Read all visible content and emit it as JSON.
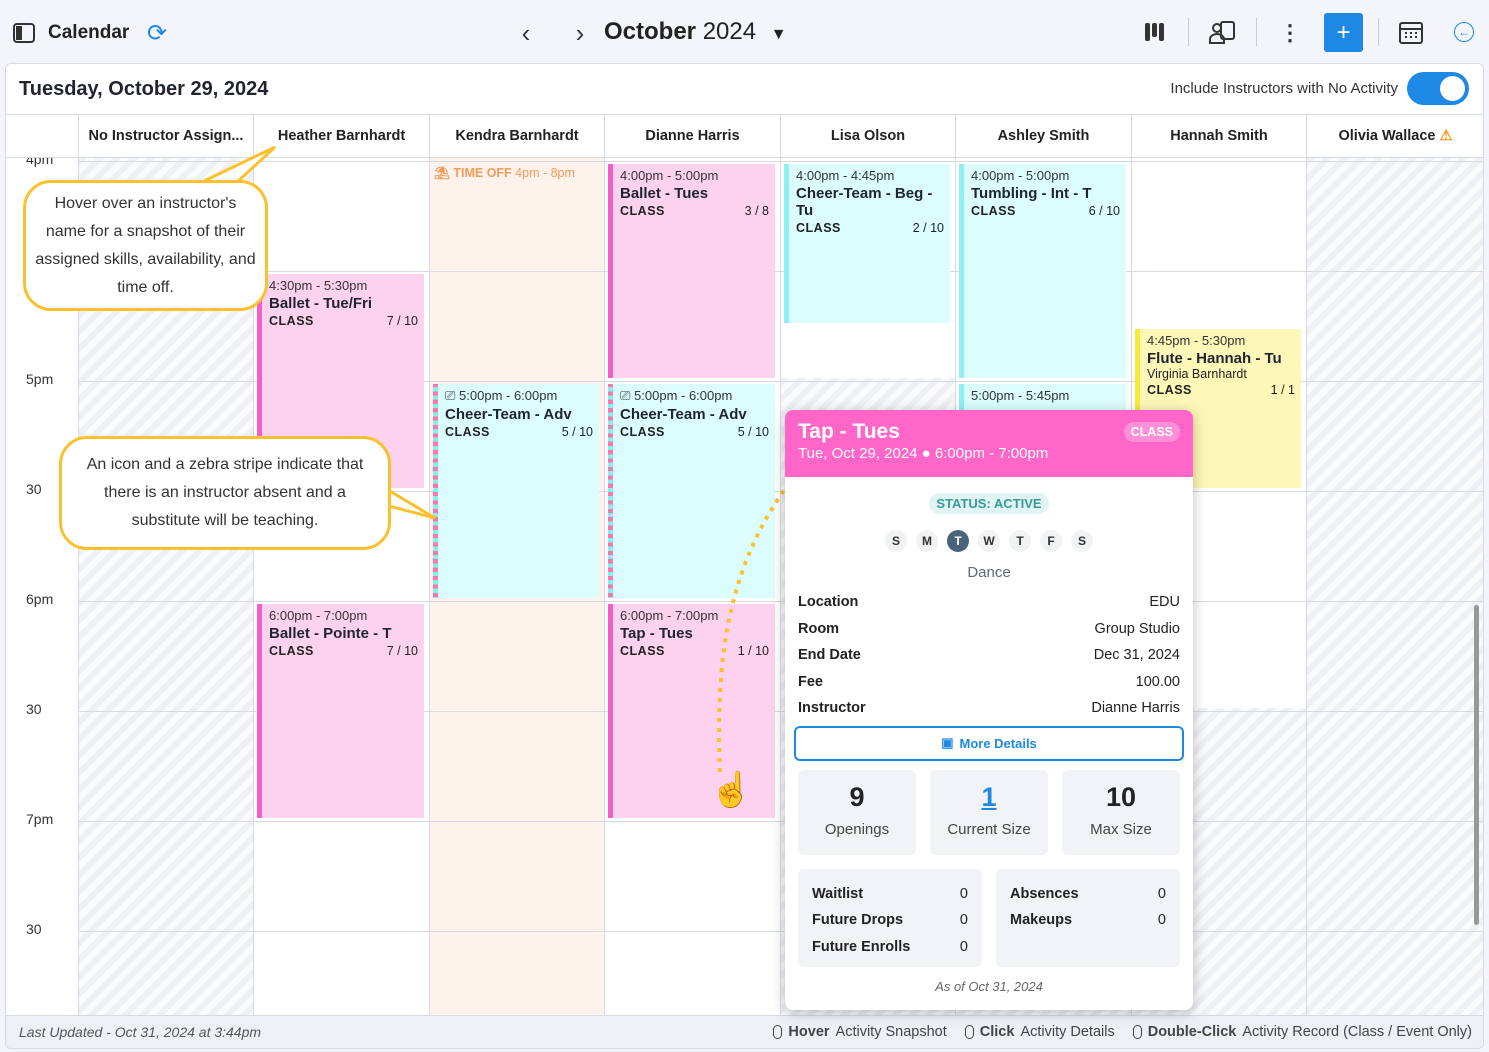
{
  "header": {
    "title": "Calendar",
    "month": "October",
    "year": "2024",
    "add_label": "+"
  },
  "panel": {
    "date_title": "Tuesday, October 29, 2024",
    "toggle_label": "Include Instructors with No Activity",
    "toggle_on": true
  },
  "instructors": [
    "No Instructor Assign...",
    "Heather Barnhardt",
    "Kendra Barnhardt",
    "Dianne Harris",
    "Lisa Olson",
    "Ashley Smith",
    "Hannah Smith",
    "Olivia Wallace"
  ],
  "time_labels": [
    "4pm",
    "",
    "5pm",
    "30",
    "6pm",
    "30",
    "7pm",
    "30"
  ],
  "time_off": {
    "label": "TIME OFF",
    "time": "4pm - 8pm",
    "instructor": "Kendra Barnhardt"
  },
  "events": [
    {
      "instructor": "Heather Barnhardt",
      "time": "4:30pm - 5:30pm",
      "name": "Ballet - Tue/Fri",
      "type": "CLASS",
      "size": "7 / 10",
      "color": "pink",
      "start": 30,
      "end": 90
    },
    {
      "instructor": "Heather Barnhardt",
      "time": "6:00pm - 7:00pm",
      "name": "Ballet - Pointe - T",
      "type": "CLASS",
      "size": "7 / 10",
      "color": "pink",
      "start": 120,
      "end": 180
    },
    {
      "instructor": "Kendra Barnhardt",
      "time": "5:00pm - 6:00pm",
      "name": "Cheer-Team - Adv",
      "type": "CLASS",
      "size": "5 / 10",
      "color": "cyan",
      "start": 60,
      "end": 120,
      "substitute": true
    },
    {
      "instructor": "Dianne Harris",
      "time": "4:00pm - 5:00pm",
      "name": "Ballet - Tues",
      "type": "CLASS",
      "size": "3 / 8",
      "color": "pink",
      "start": 0,
      "end": 60
    },
    {
      "instructor": "Dianne Harris",
      "time": "5:00pm - 6:00pm",
      "name": "Cheer-Team - Adv",
      "type": "CLASS",
      "size": "5 / 10",
      "color": "cyan",
      "start": 60,
      "end": 120,
      "substitute": true
    },
    {
      "instructor": "Dianne Harris",
      "time": "6:00pm - 7:00pm",
      "name": "Tap - Tues",
      "type": "CLASS",
      "size": "1 / 10",
      "color": "pink",
      "start": 120,
      "end": 180
    },
    {
      "instructor": "Lisa Olson",
      "time": "4:00pm - 4:45pm",
      "name": "Cheer-Team - Beg - Tu",
      "type": "CLASS",
      "size": "2 / 10",
      "color": "cyan",
      "start": 0,
      "end": 45
    },
    {
      "instructor": "Ashley Smith",
      "time": "4:00pm - 5:00pm",
      "name": "Tumbling - Int - T",
      "type": "CLASS",
      "size": "6 / 10",
      "color": "cyan",
      "start": 0,
      "end": 60
    },
    {
      "instructor": "Ashley Smith",
      "time": "5:00pm - 5:45pm",
      "name": "",
      "type": "",
      "size": "",
      "color": "cyan",
      "start": 60,
      "end": 105
    },
    {
      "instructor": "Hannah Smith",
      "time": "4:45pm - 5:30pm",
      "name": "Flute - Hannah - Tu",
      "sub_name": "Virginia Barnhardt",
      "type": "CLASS",
      "size": "1 / 1",
      "color": "yellow",
      "start": 45,
      "end": 90
    }
  ],
  "callouts": {
    "hover": "Hover over an instructor's name for a snapshot of their assigned skills, availability, and time off.",
    "zebra": "An icon and a zebra stripe indicate that there is an instructor absent and a substitute will be teaching."
  },
  "popup": {
    "title": "Tap - Tues",
    "badge": "CLASS",
    "datetime": "Tue, Oct 29, 2024 ● 6:00pm - 7:00pm",
    "status": "STATUS: ACTIVE",
    "days": [
      "S",
      "M",
      "T",
      "W",
      "T",
      "F",
      "S"
    ],
    "active_day": 2,
    "category": "Dance",
    "fields": [
      [
        "Location",
        "EDU"
      ],
      [
        "Room",
        "Group Studio"
      ],
      [
        "End Date",
        "Dec 31, 2024"
      ],
      [
        "Fee",
        "100.00"
      ],
      [
        "Instructor",
        "Dianne Harris"
      ]
    ],
    "more_details": "More Details",
    "stats": [
      [
        "9",
        "Openings"
      ],
      [
        "1",
        "Current Size"
      ],
      [
        "10",
        "Max Size"
      ]
    ],
    "left_box": [
      [
        "Waitlist",
        "0"
      ],
      [
        "Future Drops",
        "0"
      ],
      [
        "Future Enrolls",
        "0"
      ]
    ],
    "right_box": [
      [
        "Absences",
        "0"
      ],
      [
        "Makeups",
        "0"
      ]
    ],
    "as_of": "As of Oct 31, 2024"
  },
  "footer": {
    "last_updated": "Last Updated - Oct 31, 2024 at 3:44pm",
    "hints": [
      [
        "Hover",
        "Activity Snapshot"
      ],
      [
        "Click",
        "Activity Details"
      ],
      [
        "Double-Click",
        "Activity Record (Class / Event Only)"
      ]
    ]
  },
  "colors": {
    "accent": "#1e88e5",
    "class_pink": "#ff66c8",
    "callout": "#fbc02d"
  }
}
